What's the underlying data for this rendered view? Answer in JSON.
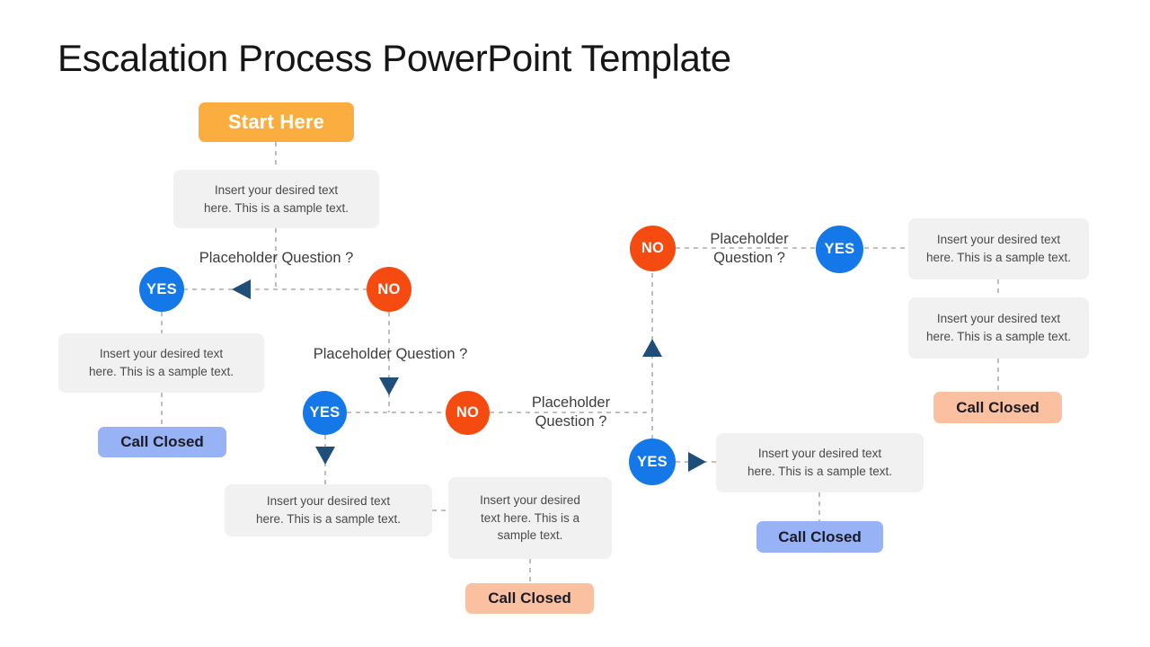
{
  "title": "Escalation Process PowerPoint Template",
  "colors": {
    "start_fill": "#fbad3f",
    "yes_fill": "#1478e8",
    "no_fill": "#f64b10",
    "textbox_fill": "#f1f1f1",
    "call_closed_blue": "#97b2f5",
    "call_closed_peach": "#fac0a0",
    "arrow_fill": "#1f4e79",
    "connector_line": "#9a9a9a",
    "title_color": "#161616"
  },
  "labels": {
    "start": "Start Here",
    "yes": "YES",
    "no": "NO",
    "call_closed": "Call Closed",
    "question": "Placeholder Question ?",
    "sample_text_line1": "Insert your desired text",
    "sample_text_line2": "here. This is a sample text.",
    "sample_text_narrow_line1": "Insert your desired",
    "sample_text_narrow_line2": "text here. This is a",
    "sample_text_narrow_line3": "sample text.",
    "question_line1": "Placeholder",
    "question_line2": "Question ?"
  },
  "nodes": {
    "start_button": {
      "label": "Start Here"
    },
    "textbox_top": {
      "line1": "Insert your desired text",
      "line2": "here. This is a sample text."
    },
    "question_1": {
      "text": "Placeholder Question ?"
    },
    "decision_1_yes": {
      "label": "YES"
    },
    "decision_1_no": {
      "label": "NO"
    },
    "textbox_left": {
      "line1": "Insert your desired text",
      "line2": "here. This is a sample text."
    },
    "call_closed_left": {
      "label": "Call Closed"
    },
    "question_2": {
      "text": "Placeholder Question ?"
    },
    "decision_2_yes": {
      "label": "YES"
    },
    "decision_2_no": {
      "label": "NO"
    },
    "question_3": {
      "line1": "Placeholder",
      "line2": "Question ?"
    },
    "textbox_bottom_left": {
      "line1": "Insert your desired text",
      "line2": "here. This is a sample text."
    },
    "textbox_bottom_mid": {
      "line1": "Insert your desired",
      "line2": "text here. This is a",
      "line3": "sample text."
    },
    "call_closed_bottom_mid": {
      "label": "Call Closed"
    },
    "decision_3_no": {
      "label": "NO"
    },
    "question_4": {
      "line1": "Placeholder",
      "line2": "Question ?"
    },
    "decision_3_yes": {
      "label": "YES"
    },
    "textbox_right_top": {
      "line1": "Insert your desired text",
      "line2": "here. This is a sample text."
    },
    "textbox_right_bottom": {
      "line1": "Insert your desired text",
      "line2": "here. This is a sample text."
    },
    "call_closed_right": {
      "label": "Call Closed"
    },
    "decision_4_yes": {
      "label": "YES"
    },
    "textbox_right_lower": {
      "line1": "Insert your desired text",
      "line2": "here. This is a sample text."
    },
    "call_closed_right_lower": {
      "label": "Call Closed"
    }
  }
}
